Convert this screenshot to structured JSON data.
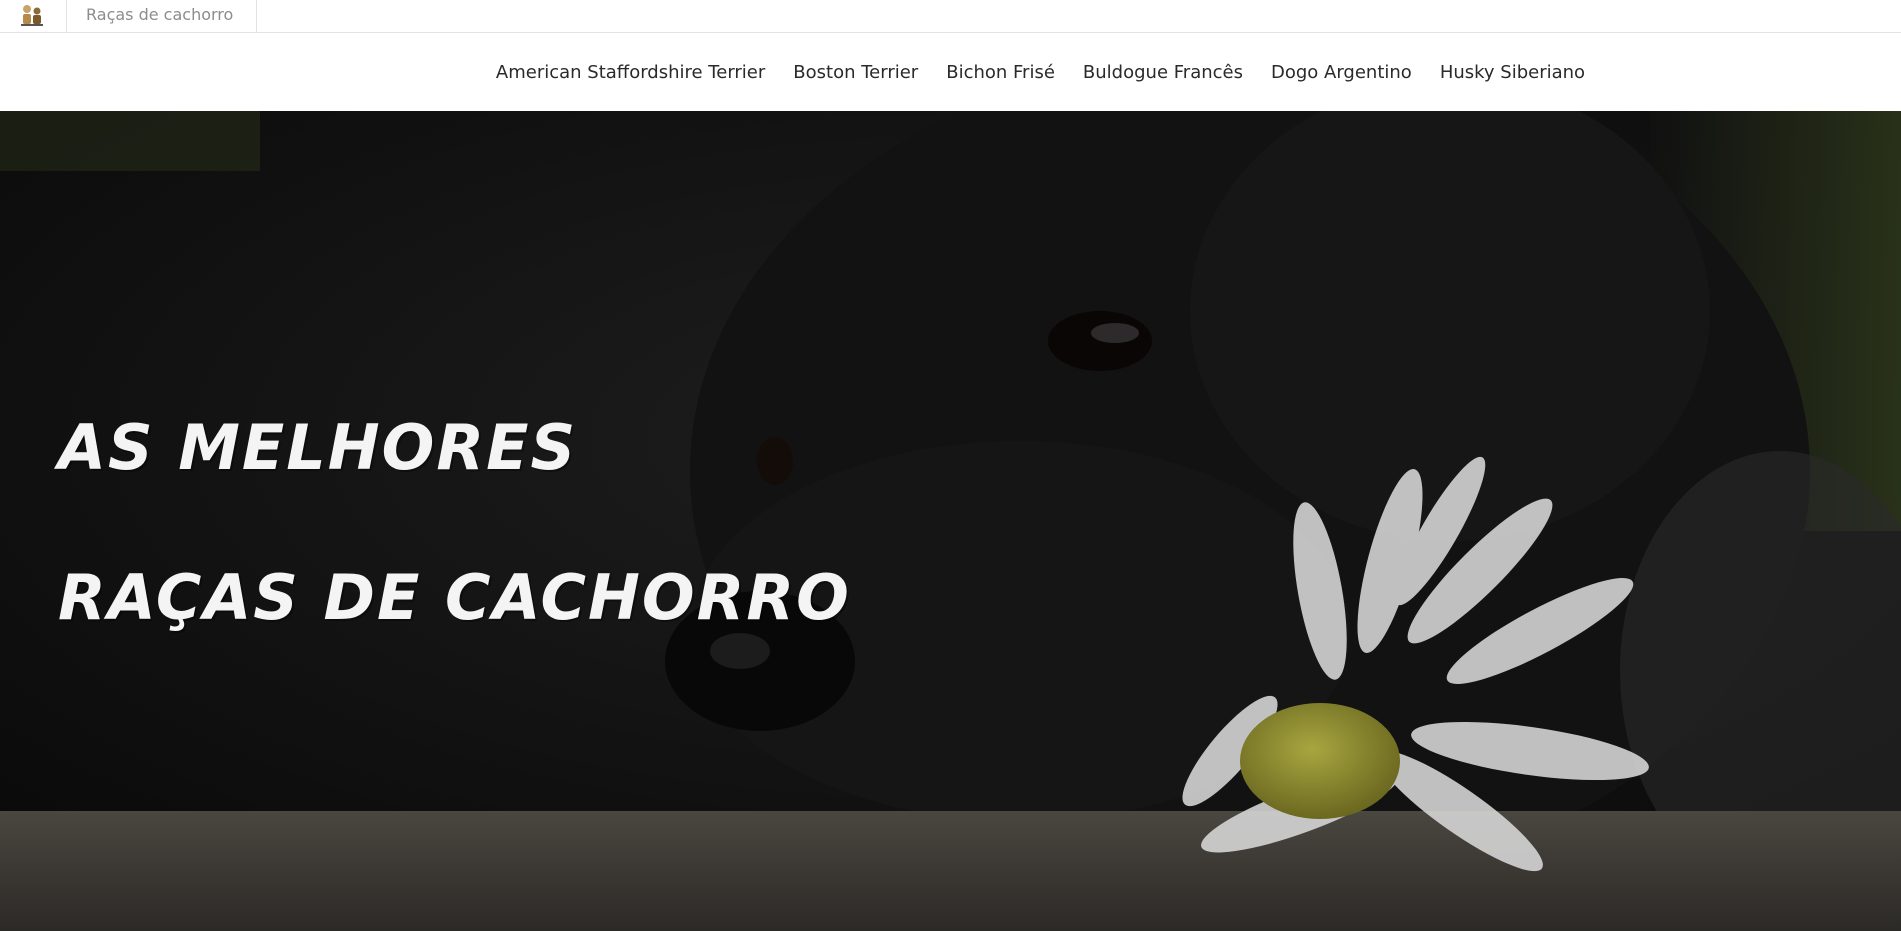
{
  "browser": {
    "favicon_icon": "dog-logo-icon",
    "tab_title": "Raças de cachorro"
  },
  "nav": {
    "links": [
      "American Staffordshire Terrier",
      "Boston Terrier",
      "Bichon Frisé",
      "Buldogue Francês",
      "Dogo Argentino",
      "Husky Siberiano"
    ]
  },
  "hero": {
    "line1": "AS MELHORES",
    "line2": "RAÇAS DE CACHORRO",
    "image": "black-dog-with-daisy-photo"
  },
  "colors": {
    "hero_text": "#f4f4f4",
    "nav_text": "#2a2a2a",
    "tab_text": "#8c8c8c"
  }
}
